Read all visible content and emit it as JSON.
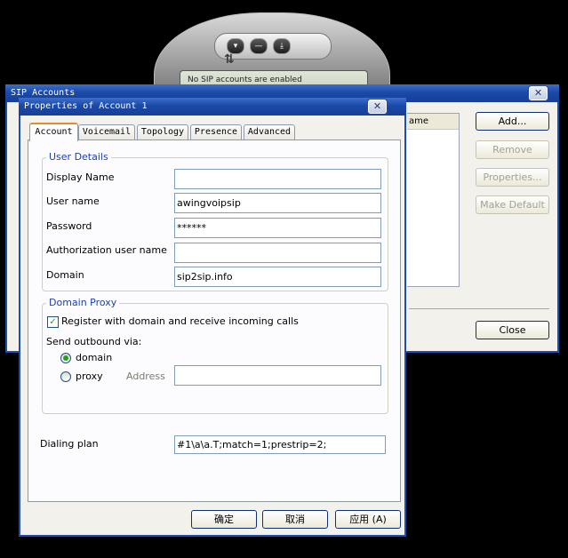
{
  "phone": {
    "status_text": "No SIP accounts are enabled",
    "buttons": [
      "▾",
      "—",
      "⤓"
    ],
    "logo": "⇅"
  },
  "sip_accounts": {
    "title": "SIP Accounts",
    "column_header": "ame",
    "buttons": {
      "add": "Add...",
      "remove": "Remove",
      "properties": "Properties...",
      "make_default": "Make Default",
      "close": "Close"
    }
  },
  "properties": {
    "title": "Properties of Account 1",
    "tabs": [
      {
        "label": "Account",
        "active": true
      },
      {
        "label": "Voicemail",
        "active": false
      },
      {
        "label": "Topology",
        "active": false
      },
      {
        "label": "Presence",
        "active": false
      },
      {
        "label": "Advanced",
        "active": false
      }
    ],
    "user_details": {
      "legend": "User Details",
      "display_name_label": "Display Name",
      "display_name_value": "",
      "user_name_label": "User name",
      "user_name_value": "awingvoipsip",
      "password_label": "Password",
      "password_value": "******",
      "auth_user_label": "Authorization user name",
      "auth_user_value": "",
      "domain_label": "Domain",
      "domain_value": "sip2sip.info"
    },
    "domain_proxy": {
      "legend": "Domain Proxy",
      "register_label": "Register with domain and receive incoming calls",
      "register_checked": true,
      "send_outbound_label": "Send outbound via:",
      "domain_option": "domain",
      "proxy_option": "proxy",
      "selected": "domain",
      "address_label": "Address",
      "address_value": ""
    },
    "dialing_plan_label": "Dialing plan",
    "dialing_plan_value": "#1\\a\\a.T;match=1;prestrip=2;",
    "buttons": {
      "ok": "确定",
      "cancel": "取消",
      "apply": "应用 (A)"
    }
  },
  "icons": {
    "close": "close-icon",
    "check": "check-icon"
  }
}
